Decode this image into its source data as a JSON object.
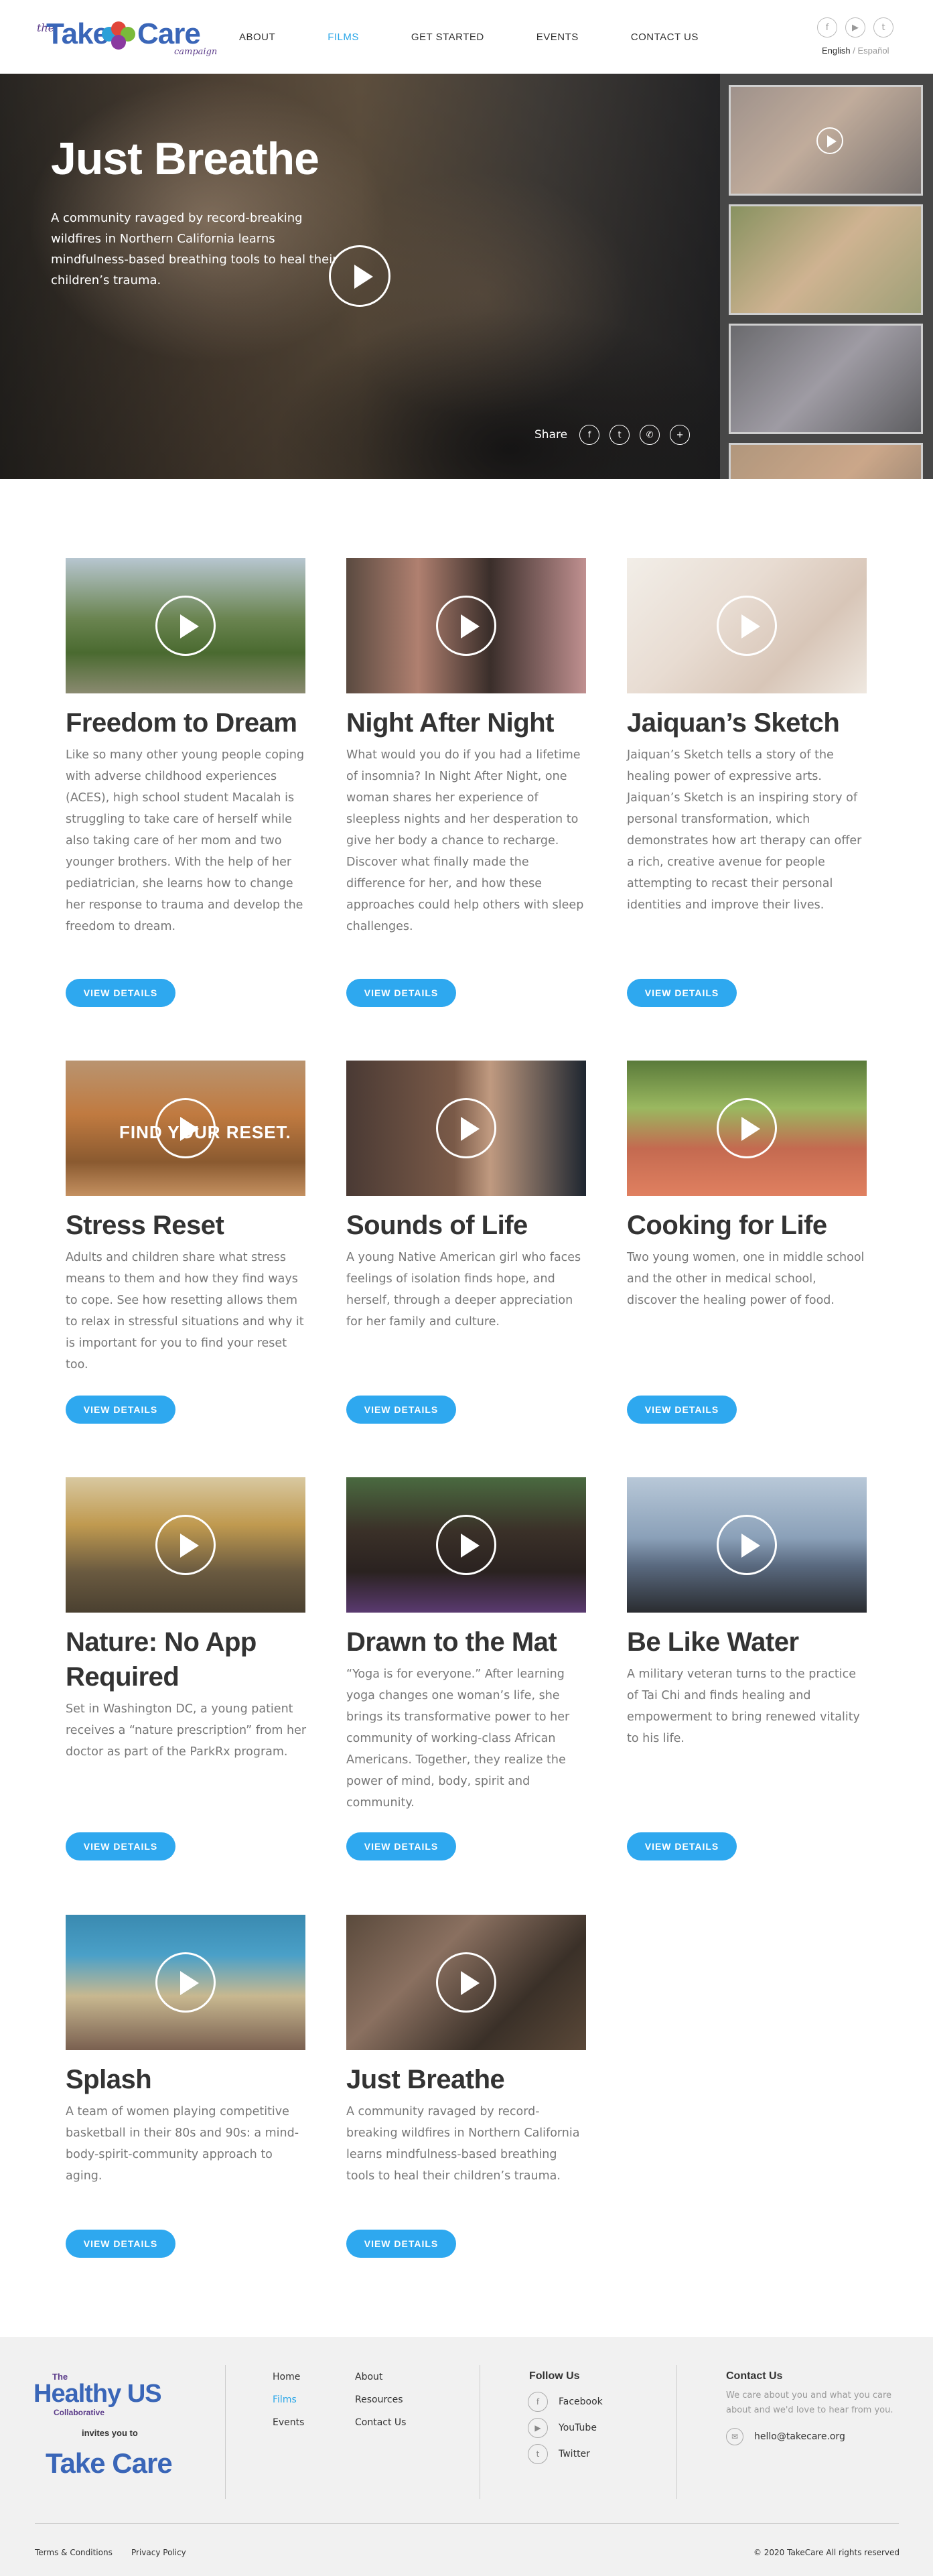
{
  "header": {
    "logo": {
      "the": "the",
      "take": "Take",
      "care": "Care",
      "campaign": "campaign"
    },
    "nav": [
      {
        "label": "ABOUT",
        "active": false
      },
      {
        "label": "FILMS",
        "active": true
      },
      {
        "label": "GET STARTED",
        "active": false
      },
      {
        "label": "EVENTS",
        "active": false
      },
      {
        "label": "CONTACT US",
        "active": false
      }
    ],
    "social_icons": [
      "facebook-icon",
      "youtube-icon",
      "twitter-icon"
    ],
    "lang": {
      "current": "English",
      "sep": " / ",
      "other": "Español"
    }
  },
  "hero": {
    "title": "Just Breathe",
    "description": "A community ravaged by record-breaking wildfires in Northern California learns mindfulness-based breathing tools to heal their children’s trauma.",
    "share_label": "Share",
    "share_icons": [
      "facebook-icon",
      "twitter-icon",
      "whatsapp-icon",
      "plus-icon"
    ]
  },
  "films": [
    {
      "title": "Freedom to Dream",
      "description": "Like so many other young people coping with adverse childhood experiences (ACES), high school student Macalah is struggling to take care of herself while also taking care of her mom and two younger brothers. With the help of her pediatrician, she learns how to change her response to trauma and develop the freedom to dream.",
      "button": "VIEW DETAILS"
    },
    {
      "title": "Night After Night",
      "description": "What would you do if you had a lifetime of insomnia? In Night After Night, one woman shares her experience of sleepless nights and her desperation to give her body a chance to recharge. Discover what finally made the difference for her, and how these approaches could help others with sleep challenges.",
      "button": "VIEW DETAILS"
    },
    {
      "title": "Jaiquan’s Sketch",
      "description": "Jaiquan’s Sketch tells a story of the healing power of expressive arts. Jaiquan’s Sketch is an inspiring story of personal transformation, which demonstrates how art therapy can offer a rich, creative avenue for people attempting to recast their personal identities and improve their lives.",
      "button": "VIEW DETAILS"
    },
    {
      "title": "Stress Reset",
      "description": "Adults and children share what stress means to them and how they find ways to cope. See how resetting allows them to relax in stressful situations and why it is important for you to find your reset too.",
      "button": "VIEW DETAILS",
      "overlay": "FIND YOUR RESET."
    },
    {
      "title": "Sounds of Life",
      "description": "A young Native American girl who faces feelings of isolation finds hope, and herself, through a deeper appreciation for her family and culture.",
      "button": "VIEW DETAILS"
    },
    {
      "title": "Cooking for Life",
      "description": "Two young women, one in middle school and the other in medical school, discover the healing power of food.",
      "button": "VIEW DETAILS"
    },
    {
      "title": "Nature: No App Required",
      "description": "Set in Washington DC, a young patient receives a “nature prescription” from her doctor as part of the ParkRx program.",
      "button": "VIEW DETAILS"
    },
    {
      "title": "Drawn to the Mat",
      "description": "“Yoga is for everyone.” After learning yoga changes one woman’s life, she brings its transformative power to her community of working-class African Americans. Together, they realize the power of mind, body, spirit and community.",
      "button": "VIEW DETAILS"
    },
    {
      "title": "Be Like Water",
      "description": "A military veteran turns to the practice of Tai Chi and finds healing and empowerment to bring renewed vitality to his life.",
      "button": "VIEW DETAILS"
    },
    {
      "title": "Splash",
      "description": "A team of women playing competitive basketball in their 80s and 90s: a mind-body-spirit-community approach to aging.",
      "button": "VIEW DETAILS"
    },
    {
      "title": "Just Breathe",
      "description": "A community ravaged by record-breaking wildfires in Northern California learns mindfulness-based breathing tools to heal their children’s trauma.",
      "button": "VIEW DETAILS"
    }
  ],
  "footer": {
    "partner_logo": {
      "the": "The",
      "name": "Healthy US",
      "collab": "Collaborative"
    },
    "invites": "invites you to",
    "logo": "Take Care",
    "links_col1": [
      {
        "label": "Home",
        "active": false
      },
      {
        "label": "Films",
        "active": true
      },
      {
        "label": "Events",
        "active": false
      }
    ],
    "links_col2": [
      "About",
      "Resources",
      "Contact Us"
    ],
    "follow_heading": "Follow Us",
    "follow": [
      {
        "icon": "facebook-icon",
        "label": "Facebook"
      },
      {
        "icon": "youtube-icon",
        "label": "YouTube"
      },
      {
        "icon": "twitter-icon",
        "label": "Twitter"
      }
    ],
    "contact_heading": "Contact Us",
    "contact_text": "We care about you and what you care about and we'd love to hear from you.",
    "contact_email": "hello@takecare.org",
    "terms": "Terms & Conditions",
    "privacy": "Privacy Policy",
    "copyright": "© 2020 TakeCare All rights reserved"
  },
  "colors": {
    "accent": "#2ea8ef",
    "logo_blue": "#3a66b8",
    "logo_purple": "#5c3c8a"
  }
}
